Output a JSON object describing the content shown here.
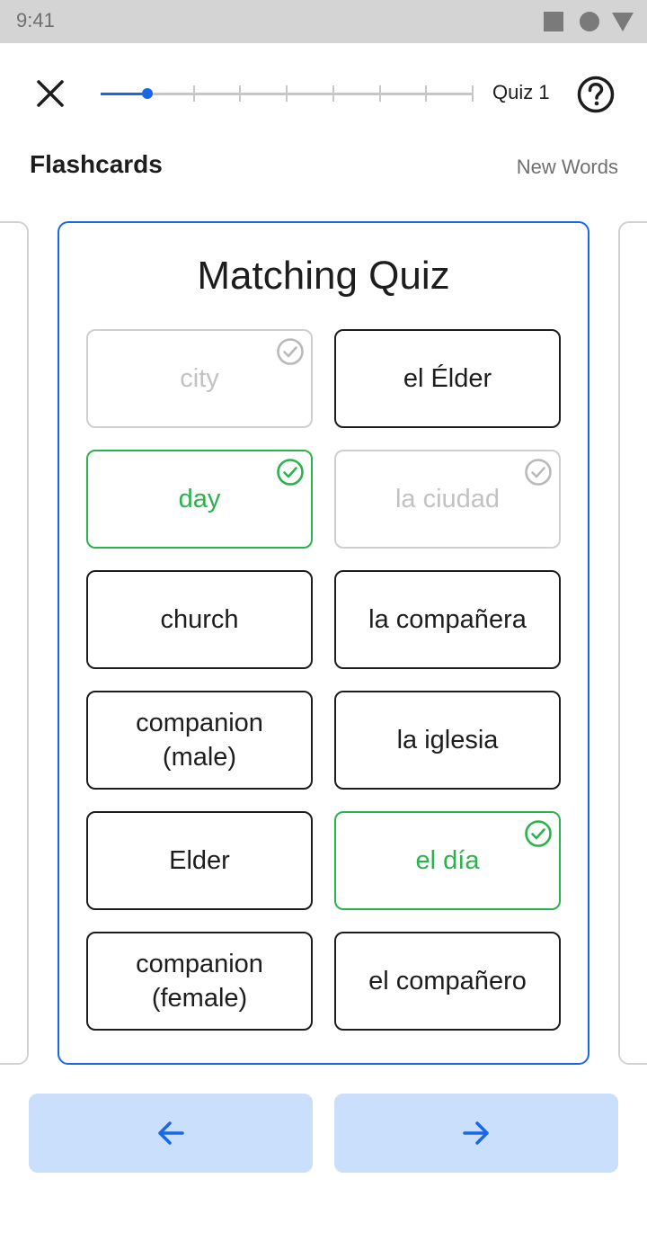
{
  "status_bar": {
    "time": "9:41"
  },
  "header": {
    "quiz_label": "Quiz 1",
    "progress": {
      "steps": 8,
      "current": 1
    }
  },
  "section": {
    "title": "Flashcards",
    "link": "New Words"
  },
  "quiz": {
    "title": "Matching Quiz",
    "tiles": [
      {
        "text": "city",
        "state": "done"
      },
      {
        "text": "el Élder",
        "state": "default"
      },
      {
        "text": "day",
        "state": "correct"
      },
      {
        "text": "la ciudad",
        "state": "done"
      },
      {
        "text": "church",
        "state": "default"
      },
      {
        "text": "la compañera",
        "state": "default"
      },
      {
        "text": "companion\n(male)",
        "state": "default"
      },
      {
        "text": "la iglesia",
        "state": "default"
      },
      {
        "text": "Elder",
        "state": "default"
      },
      {
        "text": "el día",
        "state": "correct"
      },
      {
        "text": "companion\n(female)",
        "state": "default"
      },
      {
        "text": "el compañero",
        "state": "default"
      }
    ]
  },
  "nav": {
    "prev_icon": "arrow-left-icon",
    "next_icon": "arrow-right-icon"
  },
  "colors": {
    "accent": "#1a66e8",
    "correct": "#2bb24c",
    "done": "#c2c2c2",
    "nav_bg": "#c9dffb"
  }
}
